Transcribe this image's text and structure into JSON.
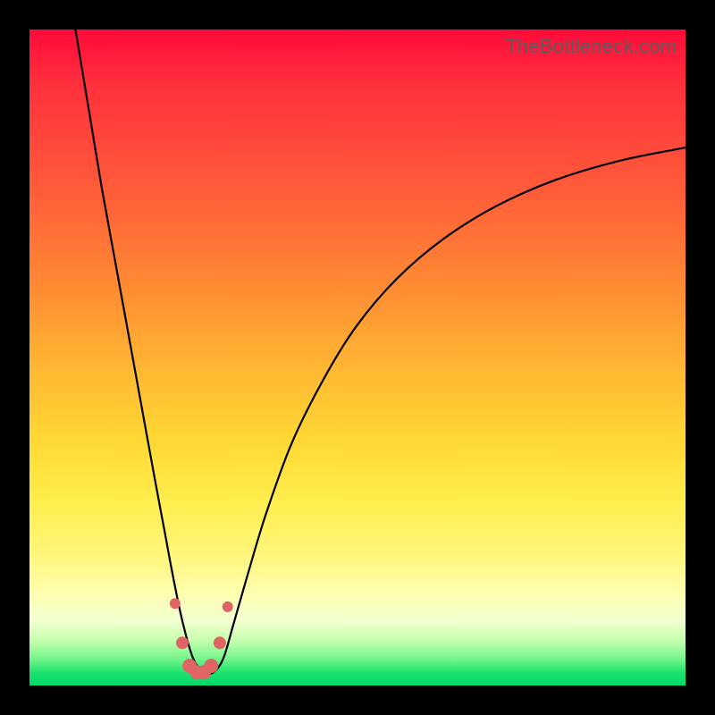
{
  "watermark": "TheBottleneck.com",
  "chart_data": {
    "type": "line",
    "title": "",
    "xlabel": "",
    "ylabel": "",
    "xlim": [
      0,
      100
    ],
    "ylim": [
      0,
      100
    ],
    "series": [
      {
        "name": "bottleneck-curve",
        "x": [
          7,
          9,
          11,
          13,
          15,
          17,
          19,
          20.5,
          22,
          23.5,
          25,
          26.5,
          28,
          29.5,
          31,
          33,
          36,
          40,
          45,
          50,
          56,
          63,
          71,
          80,
          90,
          100
        ],
        "y": [
          100,
          88,
          76,
          65,
          54,
          43,
          32,
          24,
          16,
          9,
          4,
          2,
          2,
          4,
          9,
          16,
          26,
          37,
          47,
          55,
          62,
          68,
          73,
          77,
          80,
          82
        ]
      }
    ],
    "markers": {
      "name": "highlighted-points",
      "x": [
        22.2,
        23.3,
        24.4,
        25.5,
        26.6,
        27.7,
        29.0,
        30.2
      ],
      "y": [
        12.5,
        6.5,
        3.0,
        2.0,
        2.0,
        3.0,
        6.5,
        12.0
      ],
      "r": [
        6,
        7,
        8,
        8,
        8,
        8,
        7,
        6
      ]
    },
    "background_gradient": {
      "top": "#ff0a3a",
      "mid": "#ffd933",
      "bottom": "#00d968"
    }
  }
}
